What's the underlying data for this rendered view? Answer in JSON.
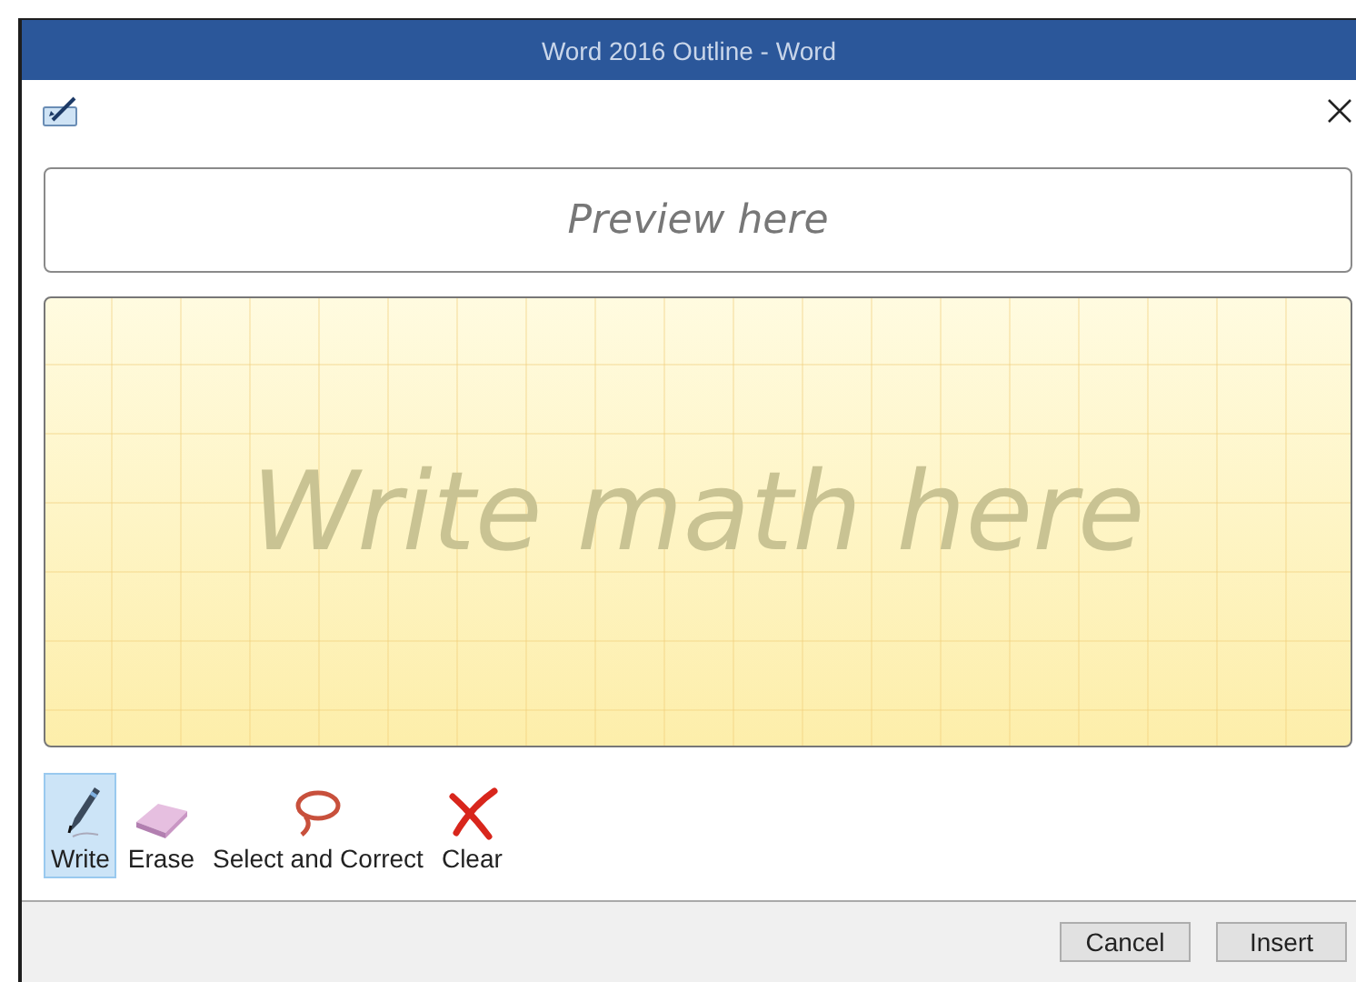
{
  "window": {
    "title": "Word 2016 Outline - Word"
  },
  "preview": {
    "placeholder": "Preview here"
  },
  "writing_area": {
    "prompt": "Write math here"
  },
  "tools": [
    {
      "kind": "write",
      "label": "Write",
      "selected": true
    },
    {
      "kind": "erase",
      "label": "Erase",
      "selected": false
    },
    {
      "kind": "select",
      "label": "Select and Correct",
      "selected": false
    },
    {
      "kind": "clear",
      "label": "Clear",
      "selected": false
    }
  ],
  "buttons": [
    "Cancel",
    "Insert"
  ]
}
